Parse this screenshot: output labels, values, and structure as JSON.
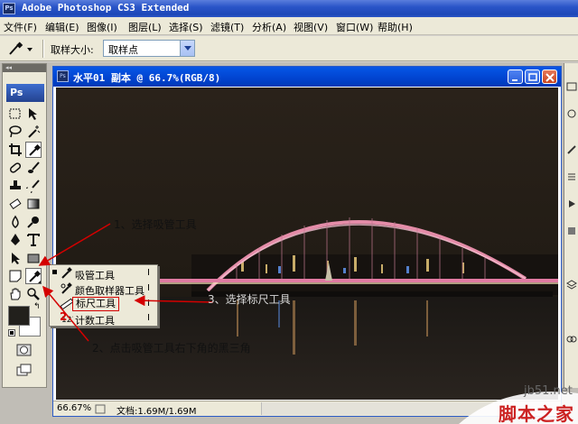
{
  "app": {
    "window_title": "Adobe Photoshop CS3 Extended",
    "badge": "Ps"
  },
  "menu": [
    "文件(F)",
    "编辑(E)",
    "图像(I)",
    "图层(L)",
    "选择(S)",
    "滤镜(T)",
    "分析(A)",
    "视图(V)",
    "窗口(W)",
    "帮助(H)"
  ],
  "options": {
    "sample_size_label": "取样大小:",
    "sample_size_value": "取样点"
  },
  "toolbox": {
    "collapse": "◂◂",
    "logo": "Ps"
  },
  "document": {
    "title": "水平01 副本 @ 66.7%(RGB/8)",
    "zoom": "66.67%",
    "status": "文档:1.69M/1.69M"
  },
  "flyout": {
    "items": [
      {
        "label": "吸管工具",
        "shortcut": "I",
        "icon": "eyedropper-icon",
        "selected": true
      },
      {
        "label": "颜色取样器工具",
        "shortcut": "I",
        "icon": "color-sampler-icon",
        "selected": false
      },
      {
        "label": "标尺工具",
        "shortcut": "I",
        "icon": "ruler-icon",
        "selected": false
      },
      {
        "label": "计数工具",
        "shortcut": "I",
        "icon": "count-icon",
        "selected": false
      }
    ]
  },
  "annotations": {
    "step1": "1、选择吸管工具",
    "step2": "2、点击吸管工具右下角的黑三角",
    "step2_marker": "2",
    "step3": "3、选择标尺工具"
  },
  "watermark": {
    "site": "jb51.net",
    "name": "脚本之家"
  },
  "colors": {
    "annotation_arrow": "#d40000",
    "foreground": "#22201c",
    "background": "#ffffff"
  }
}
